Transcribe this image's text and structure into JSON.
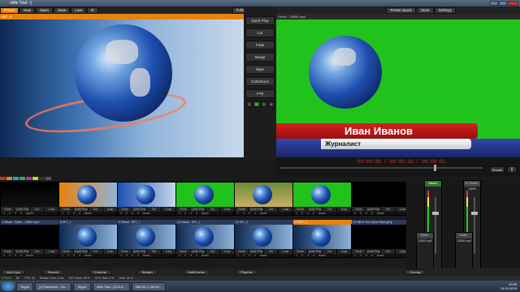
{
  "window": {
    "title": "vMix Trial - ["
  },
  "topbar": {
    "items": [
      "Preset",
      "New",
      "Open",
      "Save",
      "Last"
    ],
    "right_items": [
      "Fullscreen",
      "Preset Inputs",
      "Store",
      "Settings"
    ]
  },
  "preview": {
    "label": "SET_3"
  },
  "output": {
    "label": "Globe - 13650.mp4"
  },
  "transitions": {
    "items": [
      "Quick Play",
      "Cut",
      "Fade",
      "Merge",
      "Wipe",
      "CubeZoom",
      "FTB"
    ],
    "numbers": [
      "1",
      "2",
      "3",
      "4"
    ]
  },
  "lower_third": {
    "name": "Иван Иванов",
    "title": "Журналист"
  },
  "timebar": {
    "timecode": "00:00:08 / 00:00:10 / 00:00:02",
    "fade_label": "Restart",
    "pause_label": "||",
    "seek_fraction": 0.76
  },
  "colors": [
    "#d23030",
    "#e08a1a",
    "#20a0d0",
    "#38b038",
    "#b030b0",
    "#d0d030",
    "#333333",
    "#555555"
  ],
  "tile_ctl": [
    "Close",
    "Quick Play",
    "Cut",
    "Loop"
  ],
  "tile_nums": [
    "1",
    "2",
    "3",
    "4",
    "Audio"
  ],
  "tiles_row1": [
    {
      "hdr": ""
    },
    {
      "hdr": ""
    },
    {
      "hdr": ""
    },
    {
      "hdr": ""
    },
    {
      "hdr": ""
    },
    {
      "hdr": ""
    },
    {
      "hdr": ""
    }
  ],
  "tiles_row2": [
    {
      "hdr": "1 Virtual - Globe - 13650.mp4"
    },
    {
      "hdr": "8 SET_1"
    },
    {
      "hdr": "9 Virtual - SET_1"
    },
    {
      "hdr": "10 Virtual - SET_1"
    },
    {
      "hdr": "11 SET_2"
    },
    {
      "hdr": "12 SET_3"
    },
    {
      "hdr": "13 Title 6 The Cloner Blue.gtzip"
    }
  ],
  "audio": {
    "master": "Master",
    "strip2": "2D Model - 13650",
    "strip3": "Globe - 13650.mp4",
    "strip4": "Globe - 13650.mp4",
    "audio_mixer": "Audio Mixer"
  },
  "bottombar": {
    "items": [
      "Add Input",
      "Record",
      "External",
      "Stream",
      "MultiCorder",
      "PlayList",
      "Overlay"
    ]
  },
  "status": {
    "res": "720p25",
    "ex": "EX",
    "fps": "FPS: 25",
    "render": "Render Time: 5 ms",
    "gpu": "GPU Mem: 25 %",
    "cpu": "CPU vMix: 5 %",
    "total": "Total: 34 %"
  },
  "taskbar": {
    "items": [
      "Skype",
      "[1] Facebook - Go...",
      "Skype",
      "vMix Trial - [13.0.0...",
      "385.36.1 | Bit 64..."
    ],
    "time": "10:59",
    "date": "24.02.2015"
  }
}
